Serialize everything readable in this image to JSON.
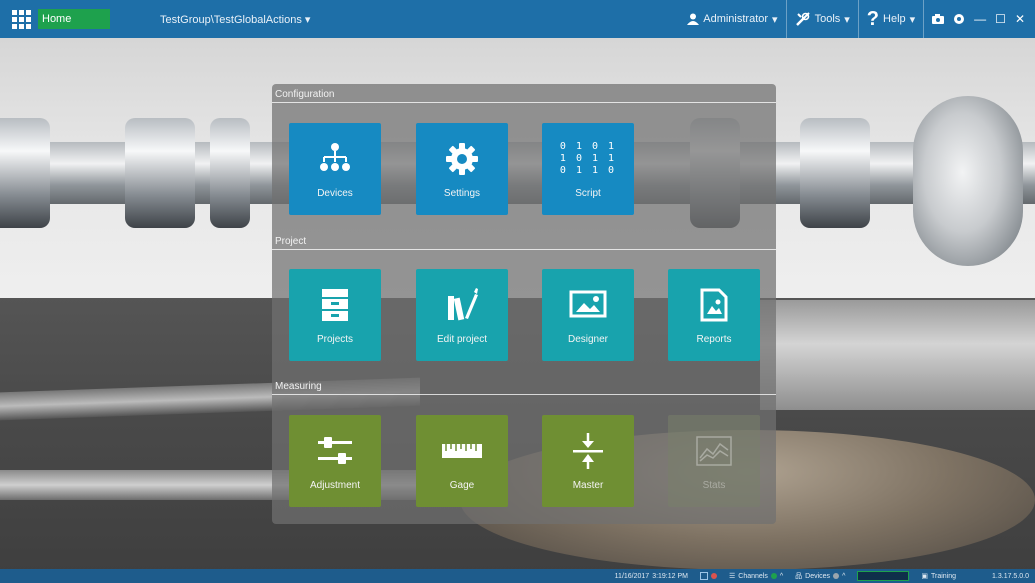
{
  "titlebar": {
    "apps_icon": "app-grid-icon",
    "home_label": "Home",
    "project_label": "TestGroup\\TestGlobalActions",
    "user_label": "Administrator",
    "tools_label": "Tools",
    "help_label": "Help",
    "icons": [
      "camera-icon",
      "record-icon",
      "minimize-icon",
      "maximize-icon",
      "close-icon"
    ]
  },
  "sections": {
    "configuration": "Configuration",
    "project": "Project",
    "measuring": "Measuring"
  },
  "tiles": {
    "configuration": [
      {
        "label": "Devices",
        "icon": "device-tree-icon"
      },
      {
        "label": "Settings",
        "icon": "gear-icon"
      },
      {
        "label": "Script",
        "icon": "binary-icon",
        "binary": [
          "0 1 0 1",
          "1 0 1 1",
          "0 1 1 0"
        ]
      }
    ],
    "project": [
      {
        "label": "Projects",
        "icon": "cabinet-icon"
      },
      {
        "label": "Edit project",
        "icon": "books-pen-icon"
      },
      {
        "label": "Designer",
        "icon": "image-frame-icon"
      },
      {
        "label": "Reports",
        "icon": "report-image-icon"
      }
    ],
    "measuring": [
      {
        "label": "Adjustment",
        "icon": "sliders-icon"
      },
      {
        "label": "Gage",
        "icon": "ruler-icon"
      },
      {
        "label": "Master",
        "icon": "master-arrows-icon"
      },
      {
        "label": "Stats",
        "icon": "chart-icon",
        "disabled": true
      }
    ]
  },
  "colors": {
    "titlebar": "#1e6fa8",
    "home_tab": "#1ea14d",
    "config_tile": "#168ac2",
    "project_tile": "#18a3ad",
    "measuring_tile": "#6f8f33",
    "statusbar": "#1e5c8c"
  },
  "statusbar": {
    "date": "11/16/2017",
    "time": "3:19:12 PM",
    "channels_label": "Channels",
    "devices_label": "Devices",
    "mode_label": "Training",
    "version": "1.3.17.5.0.0"
  }
}
